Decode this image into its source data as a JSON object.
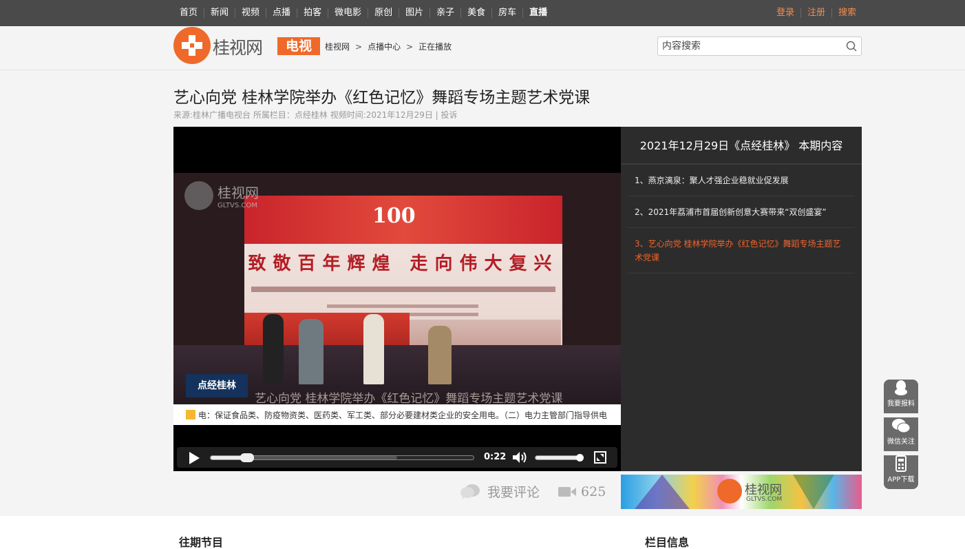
{
  "nav": {
    "items": [
      "首页",
      "新闻",
      "视频",
      "点播",
      "拍客",
      "微电影",
      "原创",
      "图片",
      "亲子",
      "美食",
      "房车",
      "直播"
    ],
    "user_links": [
      "登录",
      "注册",
      "搜索"
    ]
  },
  "header": {
    "logo_text": "桂视网",
    "tv_badge": "电视",
    "breadcrumb": [
      "桂视网",
      "点播中心",
      "正在播放"
    ],
    "breadcrumb_sep": ">",
    "search_placeholder": "内容搜索"
  },
  "video": {
    "title": "艺心向党 桂林学院举办《红色记忆》舞蹈专场主题艺术党课",
    "source": "来源:桂林广播电视台",
    "column": "所属栏目：点经桂林",
    "date": "视频时间:2021年12月29日",
    "divider": "|",
    "complain": "投诉"
  },
  "frame": {
    "watermark": "桂视网",
    "watermark_sub": "GLTVS.COM",
    "screen_number": "100",
    "slogan": "致敬百年辉煌 走向伟大复兴",
    "program_logo": "点经桂林",
    "caption": "艺心向党 桂林学院举办《红色记忆》舞蹈专场主题艺术党课",
    "ticker": "电：保证食品类、防疫物资类、医药类、军工类、部分必要建材类企业的安全用电。（二）电力主管部门指导供电"
  },
  "player": {
    "current_time": "0:22",
    "played_fraction": 0.14,
    "buffered_fraction": 0.71,
    "volume_fraction": 0.95
  },
  "playlist": {
    "title": "2021年12月29日《点经桂林》 本期内容",
    "items": [
      "1、燕京漓泉：聚人才强企业稳就业促发展",
      "2、2021年荔浦市首届创新创意大赛带来“双创盛宴”",
      "3、艺心向党 桂林学院举办《红色记忆》舞蹈专场主题艺术党课"
    ],
    "active_index": 2
  },
  "stats": {
    "comment_label": "我要评论",
    "view_count": "625"
  },
  "ad": {
    "logo_text": "桂视网",
    "sub": "GLTVS.COM"
  },
  "sections": {
    "past": "往期节目",
    "info": "栏目信息"
  },
  "side": {
    "report": "我要报料",
    "wechat": "微信关注",
    "app": "APP下载"
  },
  "colors": {
    "accent": "#ef6a2a",
    "active_item": "#f2642a",
    "nav_bg": "#4a4a4a",
    "user_link": "#f58b4c"
  },
  "icons": [
    "search-icon",
    "play-icon",
    "volume-icon",
    "fullscreen-icon",
    "comment-icon",
    "video-count-icon",
    "qq-icon",
    "wechat-icon",
    "phone-icon"
  ]
}
